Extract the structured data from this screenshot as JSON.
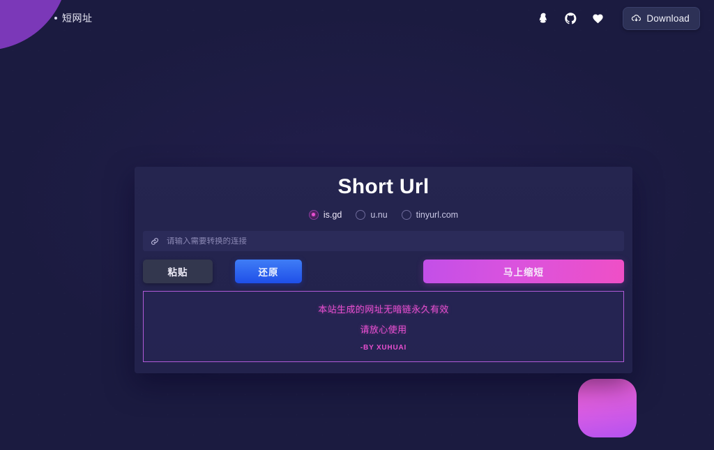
{
  "header": {
    "brand_label": "短网址",
    "icons": [
      {
        "name": "qq-icon",
        "label": "QQ"
      },
      {
        "name": "github-icon",
        "label": "GitHub"
      },
      {
        "name": "heart-icon",
        "label": "Favorite"
      }
    ],
    "download_button": {
      "label": "Download",
      "icon": "cloud-download-icon"
    }
  },
  "card": {
    "title": "Short Url",
    "providers": [
      {
        "label": "is.gd",
        "selected": true
      },
      {
        "label": "u.nu",
        "selected": false
      },
      {
        "label": "tinyurl.com",
        "selected": false
      }
    ],
    "input": {
      "icon": "link-icon",
      "value": "",
      "placeholder": "请输入需要转换的连接"
    },
    "buttons": {
      "paste": "粘贴",
      "restore": "还原",
      "shorten": "马上缩短"
    },
    "notice": {
      "line1": "本站生成的网址无暗链永久有效",
      "line2": "请放心使用",
      "signature": "-BY XUHUAI"
    }
  },
  "theme": {
    "background": "#1b1b40",
    "card_bg": "#232350",
    "accent_pink": "#e74fd0",
    "accent_purple": "#b05ad8",
    "accent_blue": "#2f62ef",
    "blob_purple": "#7b38b8",
    "download_bg": "#2d3156"
  }
}
